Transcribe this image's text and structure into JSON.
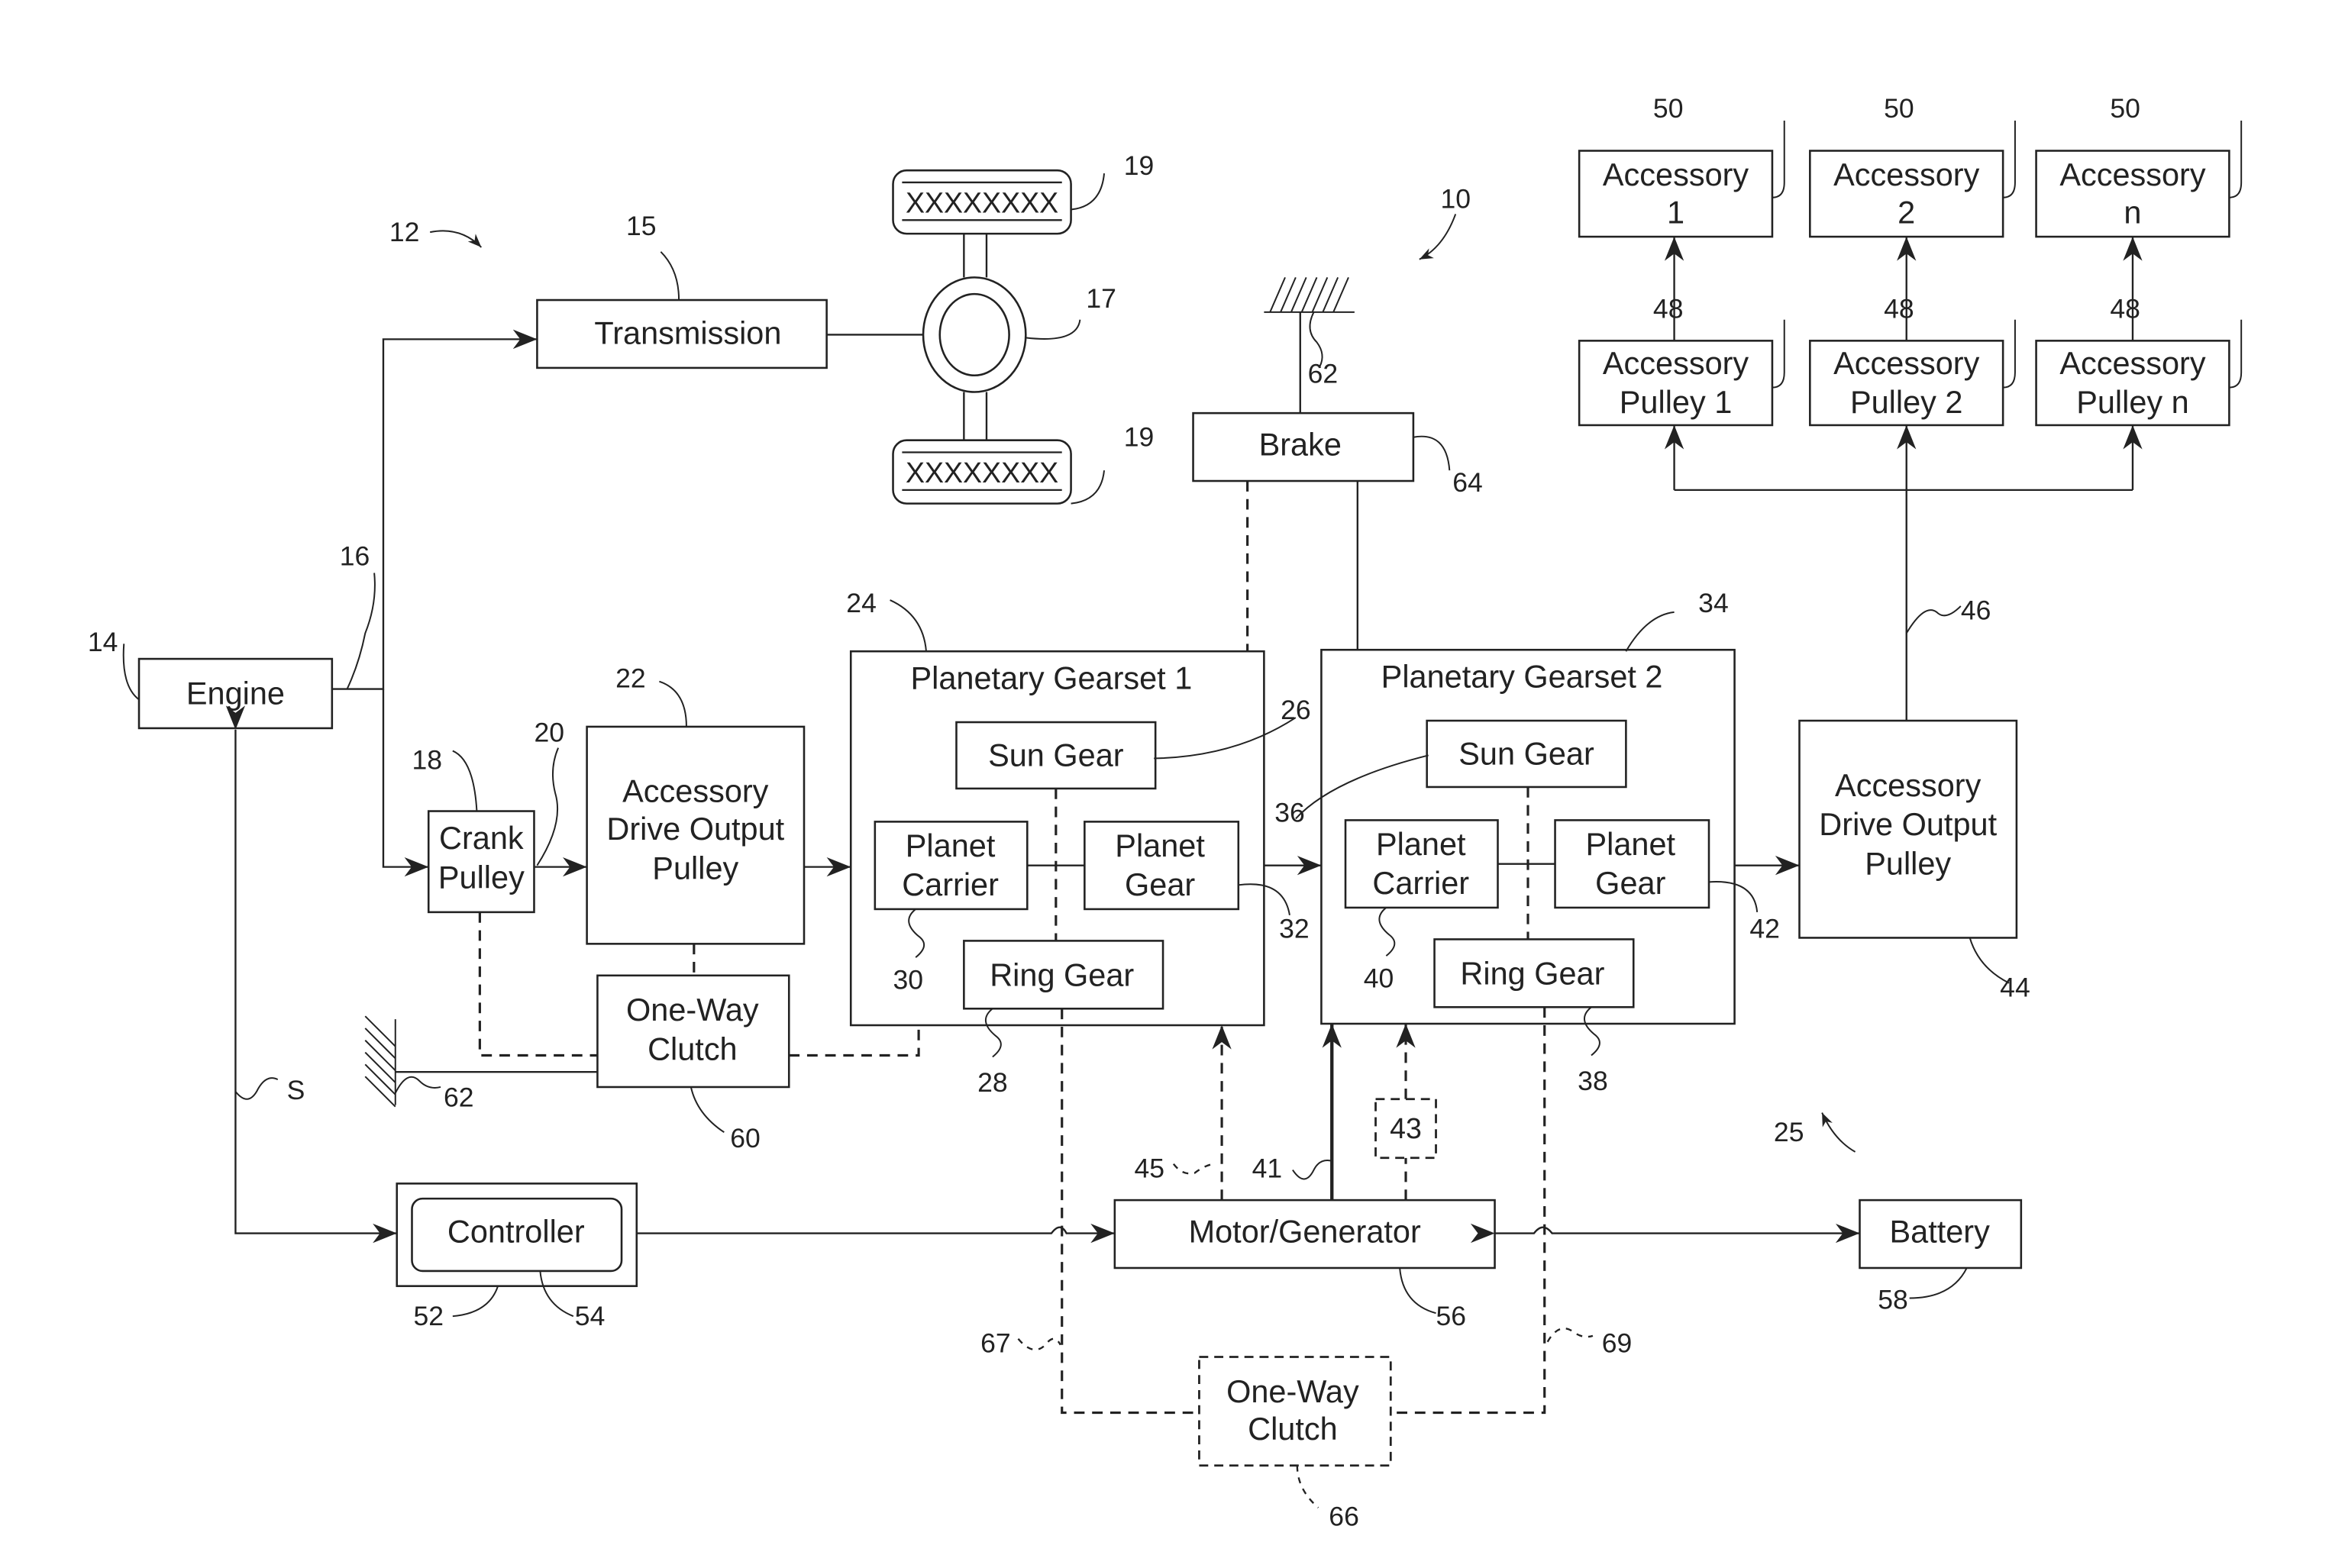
{
  "figure": {
    "blocks": {
      "transmission": "Transmission",
      "engine": "Engine",
      "crank_pulley": [
        "Crank",
        "Pulley"
      ],
      "adop_1": [
        "Accessory",
        "Drive Output",
        "Pulley"
      ],
      "one_way_clutch_1": [
        "One-Way",
        "Clutch"
      ],
      "controller": "Controller",
      "brake": "Brake",
      "pg1": {
        "title": "Planetary Gearset 1",
        "sun": "Sun Gear",
        "carrier": [
          "Planet",
          "Carrier"
        ],
        "planet": [
          "Planet",
          "Gear"
        ],
        "ring": "Ring Gear"
      },
      "pg2": {
        "title": "Planetary Gearset 2",
        "sun": "Sun Gear",
        "carrier": [
          "Planet",
          "Carrier"
        ],
        "planet": [
          "Planet",
          "Gear"
        ],
        "ring": "Ring Gear"
      },
      "adop_2": [
        "Accessory",
        "Drive Output",
        "Pulley"
      ],
      "motor_generator": "Motor/Generator",
      "battery": "Battery",
      "one_way_clutch_2": [
        "One-Way",
        "Clutch"
      ],
      "box_43": "43",
      "tire_text": "XXXXXXXX",
      "accessories": [
        {
          "line1": "Accessory",
          "line2": "1"
        },
        {
          "line1": "Accessory",
          "line2": "2"
        },
        {
          "line1": "Accessory",
          "line2": "n"
        }
      ],
      "accessory_pulleys": [
        {
          "line1": "Accessory",
          "line2": "Pulley 1"
        },
        {
          "line1": "Accessory",
          "line2": "Pulley 2"
        },
        {
          "line1": "Accessory",
          "line2": "Pulley n"
        }
      ]
    },
    "refs": {
      "r10": "10",
      "r12": "12",
      "r14": "14",
      "r15": "15",
      "r16": "16",
      "r17": "17",
      "r18": "18",
      "r19a": "19",
      "r19b": "19",
      "r20": "20",
      "r22": "22",
      "r24": "24",
      "r25": "25",
      "r26": "26",
      "r28": "28",
      "r30": "30",
      "r32": "32",
      "r34": "34",
      "r36": "36",
      "r38": "38",
      "r40": "40",
      "r41": "41",
      "r42": "42",
      "r44": "44",
      "r45": "45",
      "r46": "46",
      "r48a": "48",
      "r48b": "48",
      "r48c": "48",
      "r50a": "50",
      "r50b": "50",
      "r50c": "50",
      "r52": "52",
      "r54": "54",
      "r56": "56",
      "r58": "58",
      "r60": "60",
      "r62a": "62",
      "r62b": "62",
      "r64": "64",
      "r66": "66",
      "r67": "67",
      "r69": "69",
      "rS": "S"
    }
  }
}
